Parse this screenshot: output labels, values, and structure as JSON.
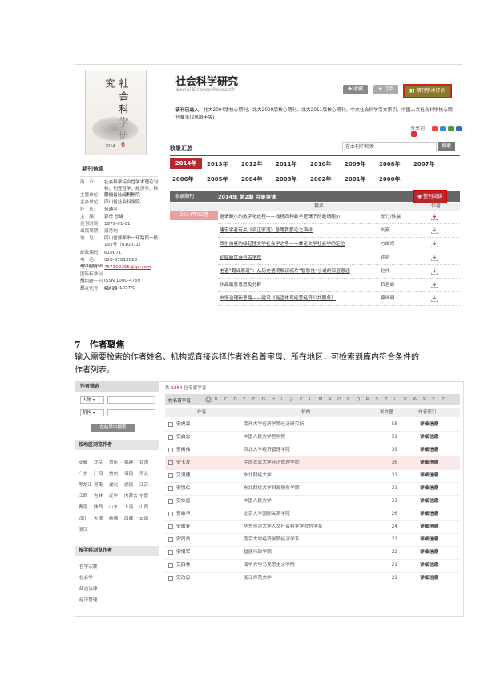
{
  "journal": {
    "title": "社会科学研究",
    "subtitle": "Social Science Research",
    "cover": {
      "calligraphy": "社会科学研究",
      "year": "2014",
      "issue": "6"
    },
    "btn_collect": "收藏",
    "btn_rss": "订阅",
    "btn_eval": "期刊学术评价",
    "cat_label": "该刊已选入：",
    "cat_text": "北大2004版核心期刊、北大2008版核心期刊、北大2011版核心期刊、中文社会科学引文索引、中国人文社会科学核心期刊要览(2008年版)",
    "share": "分享到：",
    "recv_title": "收录汇总",
    "search_placeholder": "在本刊中检索",
    "search_btn": "搜索",
    "years_row1": [
      "2014年",
      "2013年",
      "2012年",
      "2011年",
      "2010年",
      "2009年",
      "2008年",
      "2007年"
    ],
    "years_row2": [
      "2006年",
      "2005年",
      "2004年",
      "2003年",
      "2002年",
      "2001年",
      "2000年"
    ],
    "bar_left": "收录期刊",
    "bar_issue": "2014年 第2期 目录导读",
    "read_btn": "整刊阅读",
    "issue_tab": "2014年02期",
    "col_title": "篇名",
    "col_author": "作者",
    "col_download": "下载",
    "articles": [
      {
        "title": "邀请鲍尔的数字化进程——浅析四种数学逻辑下的邀请鲍尔",
        "author": "邱竹/徐晨"
      },
      {
        "title": "建宏学者有关《名正家道》急等我那论之演绎",
        "author": "刘巍"
      },
      {
        "title": "西尔伯曼的缘起性文学社会学之争——兼论文学社会学的定位",
        "author": "方维规"
      },
      {
        "title": "论赋新世诗与古学校",
        "author": "许结"
      },
      {
        "title": "老者“翻译原道”：从历史语境解读鸦片“智慧社”小说的深层意涵",
        "author": "赵伟"
      },
      {
        "title": "作品属意意思及分群",
        "author": "石君颖"
      },
      {
        "title": "市场治理新思路——建设《能否体现经营经济公共服务》",
        "author": "蔡继明"
      }
    ],
    "info": {
      "header": "期刊信息",
      "rows": [
        {
          "k": "简　介:",
          "v": "社会科学综合性学术理论刊物，刊登哲学、经济学、科学社...>>更多"
        },
        {
          "k": "主管单位:",
          "v": "四川省社会科学院"
        },
        {
          "k": "主办单位:",
          "v": "四川省社会科学院"
        },
        {
          "k": "社　长:",
          "v": "何通平"
        },
        {
          "k": "主　编:",
          "v": "郭丹 总编"
        },
        {
          "k": "创刊时间:",
          "v": "1979-01-01"
        },
        {
          "k": "出版周期:",
          "v": "双月刊"
        },
        {
          "k": "地　址:",
          "v": "四川省成都市一环路西一段155号（610071）"
        },
        {
          "k": "邮政编码:",
          "v": "610071"
        },
        {
          "k": "电　话:",
          "v": "028-87013623 66289996"
        },
        {
          "k": "电子邮件:",
          "v": "767102265@qq.com"
        },
        {
          "k": "国际标准刊号:",
          "v": "ISSN 1000-4769"
        },
        {
          "k": "国内统一刊号:",
          "v": "CN 51-1037/C"
        },
        {
          "k": "邮发代号:",
          "v": "62-13"
        }
      ]
    }
  },
  "section": {
    "title": "7　作者聚焦",
    "desc": "输入需要检索的作者姓名、机构或直接选择作者姓名首字母、所在地区，可检索到库内符合条件的作者列表。"
  },
  "authors": {
    "filter_title": "作者筛选",
    "sel_person": "人物",
    "sel_org": "机构",
    "filter_btn": "在结果中搜索",
    "region_title": "按地区浏览作者",
    "regions": [
      "安徽",
      "北京",
      "重庆",
      "福建",
      "甘肃",
      "广东",
      "广西",
      "贵州",
      "海南",
      "河北",
      "黑龙江",
      "河南",
      "湖北",
      "湖南",
      "江苏",
      "江西",
      "吉林",
      "辽宁",
      "内蒙古",
      "宁夏",
      "青海",
      "陕西",
      "山东",
      "上海",
      "山西",
      "四川",
      "天津",
      "新疆",
      "西藏",
      "云南",
      "浙江"
    ],
    "subject_title": "按学科浏览作者",
    "subjects": [
      "哲学宗教",
      "社会学",
      "政治法律",
      "经济管理"
    ],
    "total_prefix": "共",
    "total_num": "1854",
    "total_suffix": "位专家学者",
    "alpha_label": "姓名首字母：",
    "letters": [
      "A",
      "B",
      "C",
      "D",
      "E",
      "F",
      "G",
      "H",
      "I",
      "J",
      "K",
      "L",
      "M",
      "N",
      "O",
      "P",
      "Q",
      "R",
      "S",
      "T",
      "U",
      "V",
      "W",
      "X",
      "Y",
      "Z"
    ],
    "col_name": "作者",
    "col_org": "机构",
    "col_count": "发文量",
    "col_index": "作者索引",
    "rows": [
      {
        "name": "安虎森",
        "org": "南开大学经济学院经济研究所",
        "count": "58",
        "link": "详细信息"
      },
      {
        "name": "安启念",
        "org": "中国人民大学哲学院",
        "count": "51",
        "link": "详细信息"
      },
      {
        "name": "安树伟",
        "org": "西北大学经济管理学院",
        "count": "39",
        "link": "详细信息"
      },
      {
        "name": "安玉发",
        "org": "中国农业大学经济管理学院",
        "count": "36",
        "link": "详细信息"
      },
      {
        "name": "艾洪德",
        "org": "东北财经大学",
        "count": "31",
        "link": "详细信息"
      },
      {
        "name": "安强仁",
        "org": "东北财经大学财政税务学院",
        "count": "31",
        "link": "详细信息"
      },
      {
        "name": "安体富",
        "org": "中国人民大学",
        "count": "31",
        "link": "详细信息"
      },
      {
        "name": "安维华",
        "org": "北京大学国际关系学院",
        "count": "26",
        "link": "详细信息"
      },
      {
        "name": "安维复",
        "org": "华东师范大学人文社会科学学院哲学系",
        "count": "24",
        "link": "详细信息"
      },
      {
        "name": "安同良",
        "org": "南京大学经济学院经济学系",
        "count": "23",
        "link": "详细信息"
      },
      {
        "name": "安增军",
        "org": "福建行政学院",
        "count": "22",
        "link": "详细信息"
      },
      {
        "name": "艾四林",
        "org": "清华大学马克思主义学院",
        "count": "21",
        "link": "详细信息"
      },
      {
        "name": "安改忠",
        "org": "浙江师范大学",
        "count": "21",
        "link": "详细信息"
      }
    ]
  },
  "colors": {
    "accent": "#b9262c",
    "gray_bar": "#666666",
    "eval_btn": "#8a7a2a"
  }
}
